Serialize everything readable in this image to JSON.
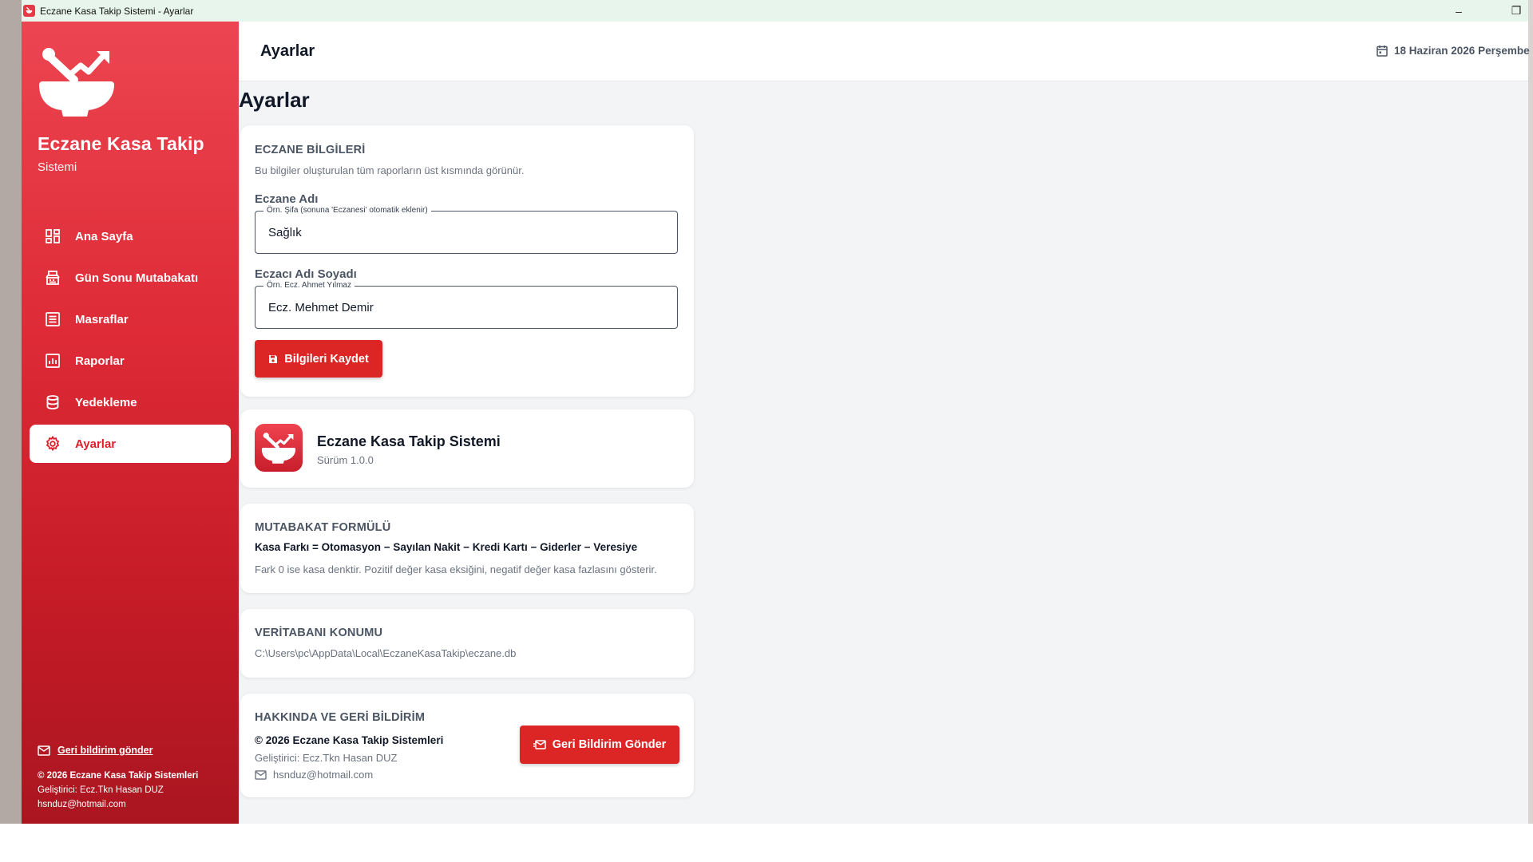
{
  "window": {
    "title": "Eczane Kasa Takip Sistemi  -  Ayarlar",
    "minimize_glyph": "–",
    "maximize_glyph": "❐"
  },
  "sidebar": {
    "brand_title": "Eczane Kasa Takip",
    "brand_subtitle": "Sistemi",
    "items": [
      {
        "label": "Ana Sayfa",
        "icon": "dashboard-icon"
      },
      {
        "label": "Gün Sonu Mutabakatı",
        "icon": "cash-register-icon"
      },
      {
        "label": "Masraflar",
        "icon": "list-icon"
      },
      {
        "label": "Raporlar",
        "icon": "bar-chart-icon"
      },
      {
        "label": "Yedekleme",
        "icon": "database-icon"
      },
      {
        "label": "Ayarlar",
        "icon": "gear-icon",
        "active": true
      }
    ],
    "feedback_link": "Geri bildirim gönder",
    "copyright": "© 2026 Eczane Kasa Takip Sistemleri",
    "developer": "Geliştirici: Ecz.Tkn Hasan DUZ",
    "email": "hsnduz@hotmail.com"
  },
  "header": {
    "title": "Ayarlar",
    "date": "18 Haziran 2026 Perşembe"
  },
  "main": {
    "page_title": "Ayarlar",
    "pharmacy_card": {
      "title": "ECZANE BİLGİLERİ",
      "description": "Bu bilgiler oluşturulan tüm raporların üst kısmında görünür.",
      "name_label": "Eczane Adı",
      "name_legend": "Örn. Şifa (sonuna 'Eczanesi' otomatik eklenir)",
      "name_value": "Sağlık",
      "pharmacist_label": "Eczacı Adı Soyadı",
      "pharmacist_legend": "Örn. Ecz. Ahmet Yılmaz",
      "pharmacist_value": "Ecz. Mehmet Demir",
      "save_button": "Bilgileri Kaydet"
    },
    "app_card": {
      "name": "Eczane Kasa Takip Sistemi",
      "version": "Sürüm 1.0.0"
    },
    "formula_card": {
      "title": "MUTABAKAT FORMÜLÜ",
      "formula": "Kasa Farkı = Otomasyon − Sayılan Nakit − Kredi Kartı − Giderler − Veresiye",
      "note": "Fark 0 ise kasa denktir. Pozitif değer kasa eksiğini, negatif değer kasa fazlasını gösterir."
    },
    "db_card": {
      "title": "VERİTABANI KONUMU",
      "path": "C:\\Users\\pc\\AppData\\Local\\EczaneKasaTakip\\eczane.db"
    },
    "about_card": {
      "title": "HAKKINDA VE GERİ BİLDİRİM",
      "copyright": "© 2026 Eczane Kasa Takip Sistemleri",
      "developer": "Geliştirici: Ecz.Tkn Hasan DUZ",
      "email": "hsnduz@hotmail.com",
      "feedback_button": "Geri Bildirim Gönder"
    }
  },
  "colors": {
    "accent": "#dc2626",
    "sidebar_top": "#ec4551",
    "sidebar_bottom": "#aa1620",
    "background": "#f3f4f6"
  }
}
